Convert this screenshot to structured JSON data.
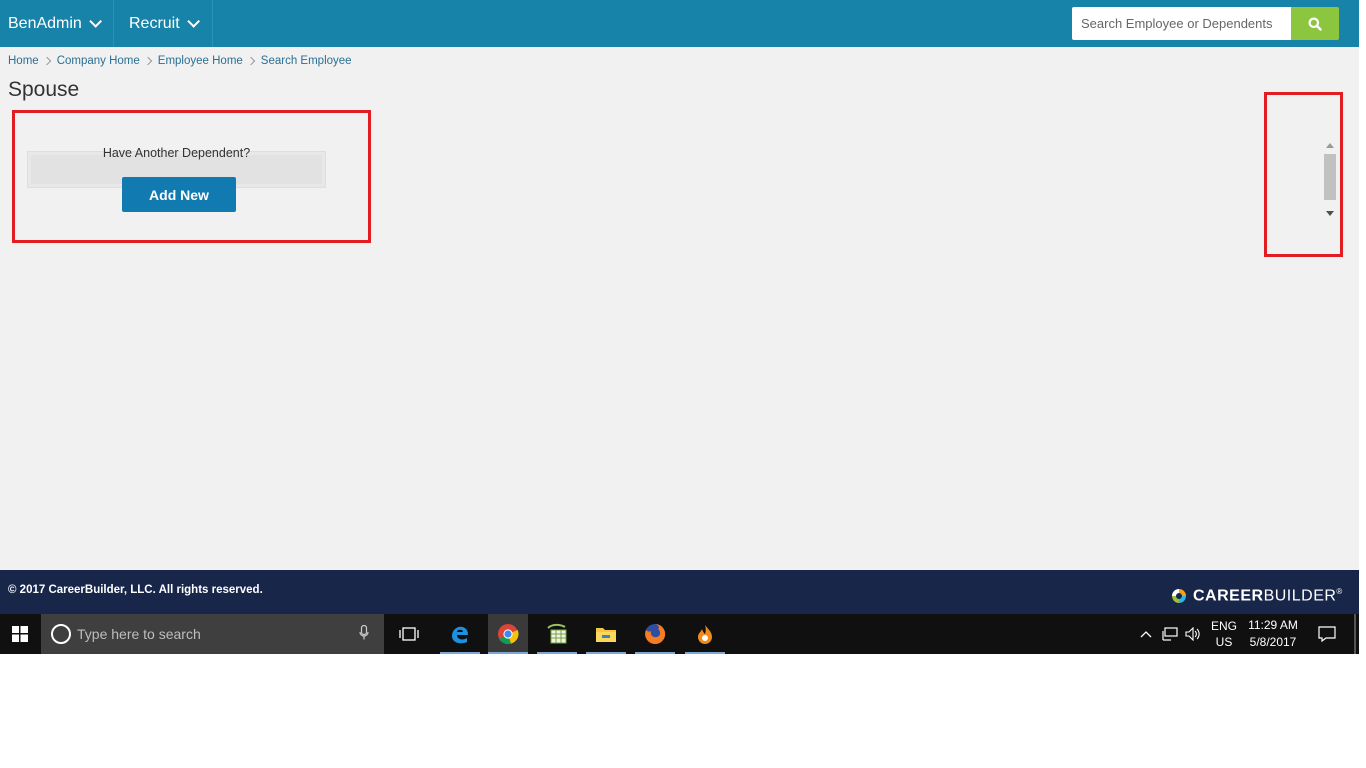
{
  "nav": {
    "menus": [
      {
        "label": "BenAdmin"
      },
      {
        "label": "Recruit"
      }
    ],
    "search_placeholder": "Search Employee or Dependents"
  },
  "breadcrumb": [
    "Home",
    "Company Home",
    "Employee Home",
    "Search Employee"
  ],
  "page": {
    "title": "Spouse",
    "dependent_prompt": "Have Another Dependent?",
    "add_new_label": "Add New"
  },
  "footer": {
    "copyright": "© 2017 CareerBuilder, LLC. All rights reserved.",
    "logo_text_bold": "CAREER",
    "logo_text_light": "BUILDER",
    "logo_mark": "®"
  },
  "taskbar": {
    "search_placeholder": "Type here to search",
    "apps": [
      "edge-icon",
      "chrome-icon",
      "spreadsheet-app-icon",
      "file-explorer-icon",
      "firefox-icon",
      "orange-app-icon"
    ],
    "lang_line1": "ENG",
    "lang_line2": "US",
    "time": "11:29 AM",
    "date": "5/8/2017"
  },
  "colors": {
    "nav_bg": "#1783a8",
    "search_button": "#8cc63f",
    "primary_button": "#117ab1",
    "footer_bg": "#18264a",
    "highlight": "#e21c23"
  }
}
